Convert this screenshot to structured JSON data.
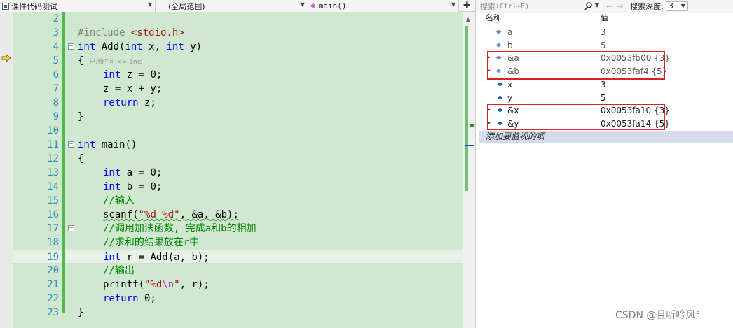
{
  "editor": {
    "nav": {
      "project": "课件代码测试",
      "scope": "(全局范围)",
      "function": "main()"
    },
    "lines": [
      {
        "n": "2"
      },
      {
        "n": "3"
      },
      {
        "n": "4"
      },
      {
        "n": "5"
      },
      {
        "n": "6"
      },
      {
        "n": "7"
      },
      {
        "n": "8"
      },
      {
        "n": "9"
      },
      {
        "n": "10"
      },
      {
        "n": "11"
      },
      {
        "n": "12"
      },
      {
        "n": "13"
      },
      {
        "n": "14"
      },
      {
        "n": "15"
      },
      {
        "n": "16"
      },
      {
        "n": "17"
      },
      {
        "n": "18"
      },
      {
        "n": "19"
      },
      {
        "n": "20"
      },
      {
        "n": "21"
      },
      {
        "n": "22"
      },
      {
        "n": "23"
      }
    ],
    "code": {
      "include_kw": "#include ",
      "include_hdr": "<stdio.h>",
      "int": "int",
      "add_sig_a": " Add(",
      "add_sig_b": " x, ",
      "add_sig_c": " y)",
      "brace_open": "{",
      "brace_close": "}",
      "time_hint": "已用时间 <= 1ms",
      "int_z": " z = 0;",
      "z_assign": "z = x + y;",
      "return_kw": "return",
      "return_z": " z;",
      "main_sig": " main()",
      "int_a": " a = 0;",
      "int_b": " b = 0;",
      "cm_input": "//输入",
      "scanf_name": "scanf",
      "scanf_open": "(",
      "scanf_fmt": "\"%d %d\"",
      "scanf_args": ", &a, &b);",
      "cm_add": "//调用加法函数, 完成a和b的相加",
      "cm_result": "//求和的结果放在r中",
      "int_r": " r = Add(a, b);",
      "cm_output": "//输出",
      "printf_open": "printf(",
      "printf_fmt_a": "\"%d",
      "printf_fmt_esc": "\\n",
      "printf_fmt_b": "\"",
      "printf_args": ", r);",
      "return_0": " 0;"
    }
  },
  "watch": {
    "search_label": "搜索",
    "search_shortcut": "(Ctrl+E)",
    "depth_label": "搜索深度:",
    "depth_value": "3",
    "col_name": "名称",
    "col_value": "值",
    "rows": [
      {
        "name": "a",
        "value": "3",
        "expandable": false,
        "icon": "watch-variable-icon"
      },
      {
        "name": "b",
        "value": "5",
        "expandable": false,
        "icon": "watch-variable-icon"
      },
      {
        "name": "&a",
        "value": "0x0053fb00 {3}",
        "expandable": true,
        "icon": "watch-variable-icon"
      },
      {
        "name": "&b",
        "value": "0x0053faf4 {5}",
        "expandable": true,
        "icon": "watch-variable-icon"
      },
      {
        "name": "x",
        "value": "3",
        "expandable": false,
        "icon": "watch-variable-icon"
      },
      {
        "name": "y",
        "value": "5",
        "expandable": false,
        "icon": "watch-variable-icon"
      },
      {
        "name": "&x",
        "value": "0x0053fa10 {3}",
        "expandable": true,
        "icon": "watch-variable-icon"
      },
      {
        "name": "&y",
        "value": "0x0053fa14 {5}",
        "expandable": true,
        "icon": "watch-variable-icon"
      }
    ],
    "add_item": "添加要监视的项"
  },
  "watermark": "CSDN @且听吟风°",
  "colors": {
    "editor_bg": "#cfe8cf",
    "keyword": "#0000ff",
    "string": "#a31515",
    "comment": "#008000",
    "line_number": "#2b91af",
    "highlight_box": "#e02020"
  }
}
